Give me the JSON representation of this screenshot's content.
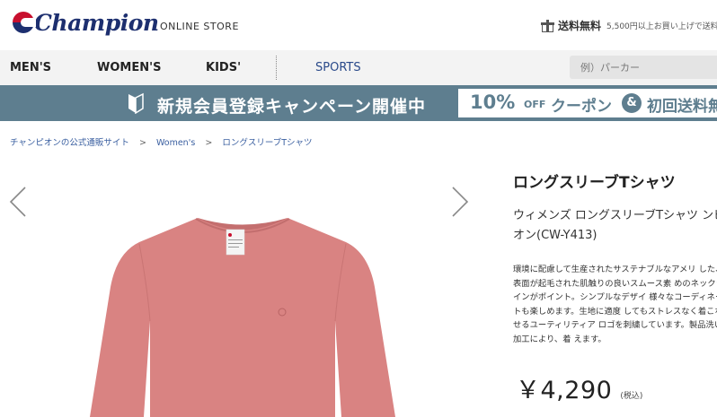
{
  "header": {
    "brand": "Champion",
    "store_label": "ONLINE STORE",
    "shipping_label": "送料無料",
    "shipping_note": "5,500円以上お買い上げで送料",
    "brand_colors": {
      "red": "#c8102e",
      "navy": "#1d2f6f"
    }
  },
  "nav": {
    "items": [
      {
        "label": "MEN'S"
      },
      {
        "label": "WOMEN'S"
      },
      {
        "label": "KIDS'"
      }
    ],
    "sports_label": "SPORTS",
    "search_placeholder": "例）パーカー"
  },
  "banner": {
    "text": "新規会員登録キャンペーン開催中",
    "coupon_percent": "10%",
    "coupon_off": "OFF",
    "coupon_word": "クーポン",
    "amp": "&",
    "first_shipping": "初回送料無",
    "color": "#5e7e8f"
  },
  "breadcrumb": [
    {
      "label": "チャンピオンの公式通販サイト"
    },
    {
      "label": "Women's"
    },
    {
      "label": "ロングスリーブTシャツ"
    }
  ],
  "breadcrumb_separator": ">",
  "gallery": {
    "prev_icon": "chevron-left-icon",
    "next_icon": "chevron-right-icon",
    "product_color": "#d98382"
  },
  "product": {
    "title": "ロングスリーブTシャツ",
    "subtitle": "ウィメンズ ロングスリーブTシャツ ンピオン(CW-Y413)",
    "description": "環境に配慮して生産されたサステナブルなアメリ した、表面が起毛された肌触りの良いスムース素 めのネックラインがポイント。シンプルなデザイ 様々なコーディネートも楽しめます。生地に適度 してもストレスなく着こなせるユーティリティア ロゴを刺繍しています。製品洗い加工により、着 えます。",
    "price": "￥4,290",
    "tax_note": "(税込)"
  }
}
